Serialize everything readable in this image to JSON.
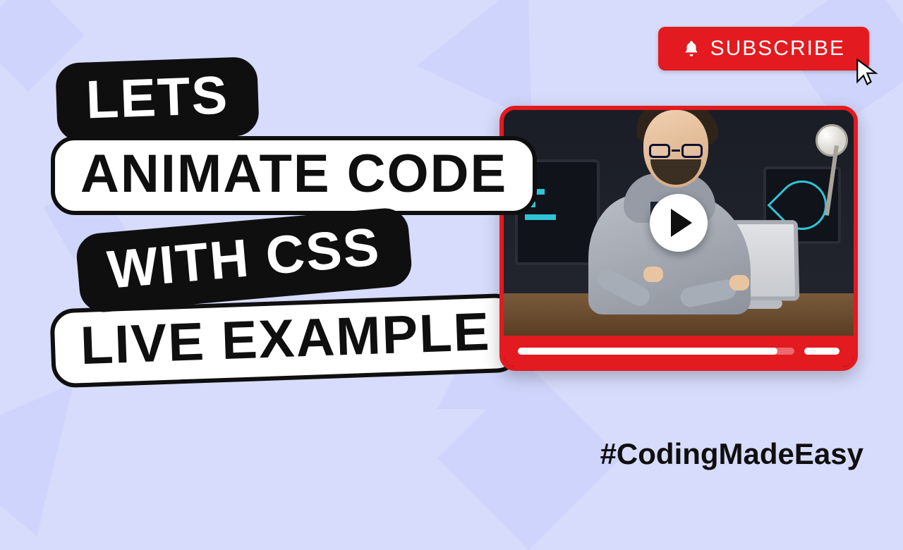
{
  "title": {
    "line1": "LETS",
    "line2": "ANIMATE CODE",
    "line3": "WITH CSS",
    "line4": "LIVE EXAMPLE"
  },
  "subscribe": {
    "label": "SUBSCRIBE"
  },
  "hashtag": "#CodingMadeEasy",
  "colors": {
    "background": "#d7dcfc",
    "accent": "#e31a1f",
    "text_dark": "#0f0f0f"
  },
  "video": {
    "progress_percent": 94
  }
}
